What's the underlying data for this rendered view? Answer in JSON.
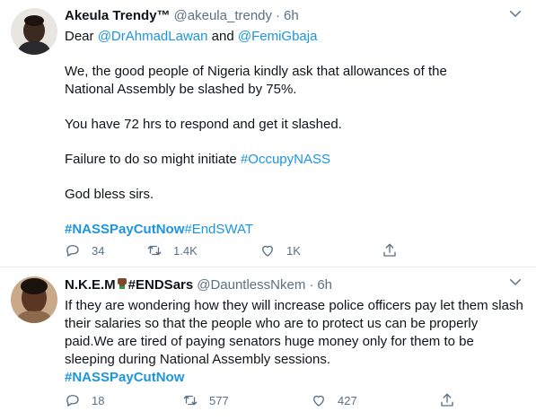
{
  "tweets": [
    {
      "author_name": "Akeula Trendy™",
      "handle": "@akeula_trendy",
      "separator": "·",
      "time": "6h",
      "line1_prefix": "Dear ",
      "mention1": "@DrAhmadLawan",
      "line1_and": " and ",
      "mention2": "@FemiGbaja",
      "para1": "We, the good people of Nigeria kindly ask that allowances of the National Assembly be slashed by 75%.",
      "para2": "You have 72 hrs to respond and get it slashed.",
      "para3_prefix": "Failure to do so might initiate ",
      "para3_tag": "#OccupyNASS",
      "para4": "God bless sirs.",
      "tag_a": "#NASSPayCutNow",
      "tag_b": "#EndSWAT",
      "replies": "34",
      "retweets": "1.4K",
      "likes": "1K"
    },
    {
      "author_name": "N.K.E.M",
      "author_suffix": "#ENDSars",
      "handle": "@DauntlessNkem",
      "separator": "·",
      "time": "6h",
      "text": "If they are wondering how they will increase police officers pay let them slash their salaries so that the people who are to protect us can be properly paid.We are tired of paying senators huge money only for them to be sleeping during National Assembly sessions.",
      "tag": "#NASSPayCutNow",
      "replies": "18",
      "retweets": "577",
      "likes": "427"
    }
  ],
  "icons": {
    "reply": "reply-icon",
    "retweet": "retweet-icon",
    "like": "heart-icon",
    "share": "share-icon",
    "more": "chevron-down-icon"
  },
  "colors": {
    "link": "#1b95e0",
    "muted": "#5b7083",
    "text": "#0f1419",
    "divider": "#e6ecf0"
  }
}
